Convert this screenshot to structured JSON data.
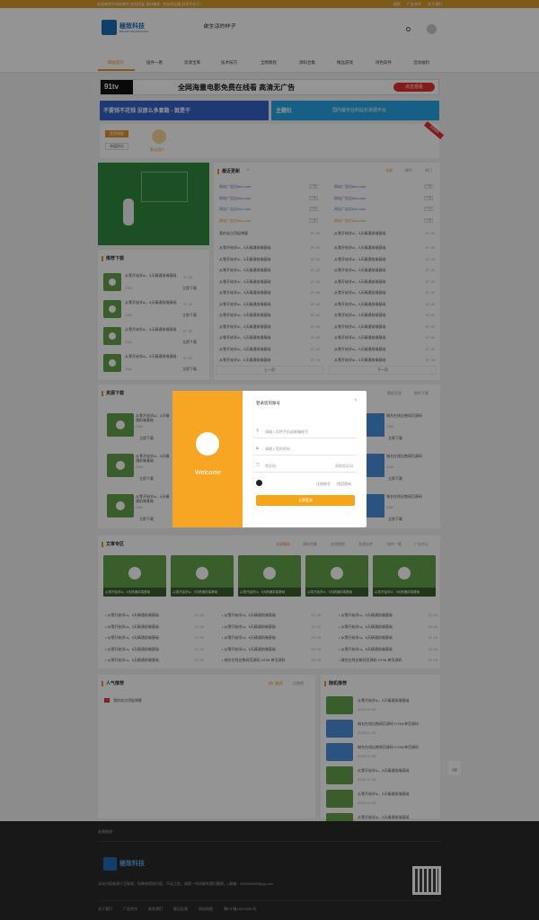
{
  "topbar": {
    "left": "欢迎来到不知的软件,这些回复,请对编程...完这样回复,好用不吃亏!",
    "links": [
      "搜索",
      "广告合作",
      "关于我们"
    ]
  },
  "header": {
    "logo_title": "極致科技",
    "logo_sub": "BOUND TECHNOLOGY",
    "slogan": "做生活的样子"
  },
  "nav": {
    "items": [
      "网站首页",
      "插件一看",
      "资源宝库",
      "技术技巧",
      "全网教程",
      "源码合集",
      "精品游戏",
      "绿色软件",
      "活动福利"
    ]
  },
  "banners": {
    "b1_brand": "91tv",
    "b1_text": "全网海量电影免费在线看 高清无广告",
    "b1_btn": "点击观看",
    "b2_left": "不要钱不花钱 没那么多套路 - 就是干",
    "b2_brand": "主题社",
    "b2_text": "国内最专业的站长资源平台"
  },
  "user": {
    "btn1": "签到领取",
    "btn2": "充值积分",
    "name": "默认用户",
    "ribbon": "资源推荐"
  },
  "latest": {
    "title": "最近更新",
    "count": "11",
    "tabs": [
      "全部",
      "精华",
      "热门"
    ],
    "ad_text": "网站广告位bdu.com",
    "ad_tag": "广告",
    "notice": "我的站点顶起博客",
    "item_text": "从零开始学ui，5天精通前端基础",
    "date": "07-25",
    "prev": "上一页",
    "next": "下一页"
  },
  "downloads": {
    "title": "推荐下载",
    "item": "从零开始学ui，5天精通前端基础",
    "meta": "23M",
    "btn": "立即下载",
    "date": "07-25"
  },
  "resources": {
    "title": "资源下载",
    "tabs": [
      "模板资源",
      "插件下载"
    ],
    "item": "从零开始学ui，5天精通前端基础",
    "meta": "23M",
    "btn": "立即下载",
    "item2": "城名在线出售网页源码"
  },
  "articles": {
    "title": "文章专区",
    "tabs": [
      "全部精选",
      "源码合集",
      "在线教程",
      "资源宝库",
      "插件一看",
      "广告中心"
    ],
    "card": "从零开始学ui，5天精通前端基础",
    "row": "从零开始学ui，5天精通前端基础",
    "row2": "城名在线出售网页源码 HTML单页源码",
    "date": "07-25"
  },
  "popular": {
    "title": "人气推荐",
    "tabs": [
      "热门推荐",
      "点赞榜"
    ],
    "item": "我的站点顶起博客"
  },
  "random": {
    "title": "随机推荐",
    "item": "从零开始学ui，5天精通前端基础",
    "item2": "城名在线出售网页源码 HTML单页源码",
    "date": "2020-07-25"
  },
  "login": {
    "title": "登录您的账号",
    "welcome": "Welcome",
    "phone_ph": "请输入您的手机或邮箱账号",
    "pwd_ph": "请输入您的密码",
    "code_ph": "验证码",
    "code_btn": "获取验证码",
    "register": "注册账号",
    "forgot": "找回密码",
    "submit": "立即登录"
  },
  "footer": {
    "links_label": "友情链接：",
    "logo": "極致科技",
    "desc": "本站内容来源于互联网，如果有侵权内容，不足之处，请第一时间联系我们删除。| 邮箱：905909000@qq.com",
    "bottom": [
      "关于我们",
      "广告合作",
      "联系我们",
      "意见反馈",
      "网站地图",
      "豫ICP备19019450号"
    ]
  },
  "backtop": "顶部"
}
